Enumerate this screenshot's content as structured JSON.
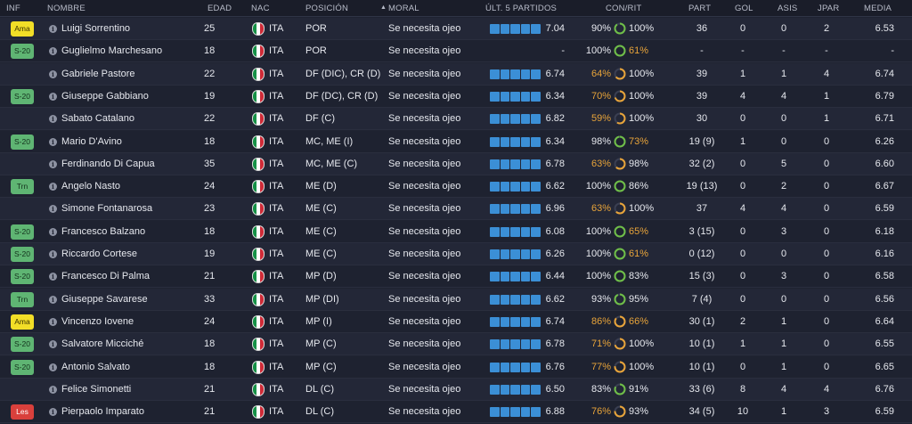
{
  "columns": {
    "inf": "INF",
    "nombre": "NOMBRE",
    "edad": "EDAD",
    "nac": "NAC",
    "posicion": "POSICIÓN",
    "moral": "MORAL",
    "ult5": "ÚLT. 5 PARTIDOS",
    "conrit": "CON/RIT",
    "part": "PART",
    "gol": "GOL",
    "asis": "ASIS",
    "jpar": "JPAR",
    "media": "MEDIA"
  },
  "sort": {
    "column": "moral",
    "direction": "ascending"
  },
  "colors": {
    "accent_blue": "#3b8fd6",
    "highlight_orange": "#e8a43a",
    "ring_green": "#6fbf48",
    "ring_orange": "#e8a43a",
    "badge_yellow": "#f2de27",
    "badge_green": "#5fb573",
    "badge_red": "#d9403c"
  },
  "players": [
    {
      "inf": "Ama",
      "inf_color": "yellow",
      "name": "Luigi Sorrentino",
      "age": "25",
      "nat": "ITA",
      "pos": "POR",
      "morale": "Se necesita ojeo",
      "last5": "7.04",
      "con": "90%",
      "con_low": false,
      "rit": "100%",
      "rit_low": false,
      "con_pct": 90,
      "rit_pct": 100,
      "part": "36",
      "gol": "0",
      "asis": "0",
      "jpar": "2",
      "media": "6.53"
    },
    {
      "inf": "S-20",
      "inf_color": "green",
      "name": "Guglielmo Marchesano",
      "age": "18",
      "nat": "ITA",
      "pos": "POR",
      "morale": "Se necesita ojeo",
      "last5": "-",
      "con": "100%",
      "con_low": false,
      "rit": "61%",
      "rit_low": true,
      "con_pct": 100,
      "rit_pct": 61,
      "part": "-",
      "gol": "-",
      "asis": "-",
      "jpar": "-",
      "media": "-"
    },
    {
      "inf": "",
      "inf_color": "",
      "name": "Gabriele Pastore",
      "age": "22",
      "nat": "ITA",
      "pos": "DF (DIC), CR (D)",
      "morale": "Se necesita ojeo",
      "last5": "6.74",
      "con": "64%",
      "con_low": true,
      "rit": "100%",
      "rit_low": false,
      "con_pct": 64,
      "rit_pct": 100,
      "part": "39",
      "gol": "1",
      "asis": "1",
      "jpar": "4",
      "media": "6.74"
    },
    {
      "inf": "S-20",
      "inf_color": "green",
      "name": "Giuseppe Gabbiano",
      "age": "19",
      "nat": "ITA",
      "pos": "DF (DC), CR (D)",
      "morale": "Se necesita ojeo",
      "last5": "6.34",
      "con": "70%",
      "con_low": true,
      "rit": "100%",
      "rit_low": false,
      "con_pct": 70,
      "rit_pct": 100,
      "part": "39",
      "gol": "4",
      "asis": "4",
      "jpar": "1",
      "media": "6.79"
    },
    {
      "inf": "",
      "inf_color": "",
      "name": "Sabato Catalano",
      "age": "22",
      "nat": "ITA",
      "pos": "DF (C)",
      "morale": "Se necesita ojeo",
      "last5": "6.82",
      "con": "59%",
      "con_low": true,
      "rit": "100%",
      "rit_low": false,
      "con_pct": 59,
      "rit_pct": 100,
      "part": "30",
      "gol": "0",
      "asis": "0",
      "jpar": "1",
      "media": "6.71"
    },
    {
      "inf": "S-20",
      "inf_color": "green",
      "name": "Mario D'Avino",
      "age": "18",
      "nat": "ITA",
      "pos": "MC, ME (I)",
      "morale": "Se necesita ojeo",
      "last5": "6.34",
      "con": "98%",
      "con_low": false,
      "rit": "73%",
      "rit_low": true,
      "con_pct": 98,
      "rit_pct": 73,
      "part": "19 (9)",
      "gol": "1",
      "asis": "0",
      "jpar": "0",
      "media": "6.26"
    },
    {
      "inf": "",
      "inf_color": "",
      "name": "Ferdinando Di Capua",
      "age": "35",
      "nat": "ITA",
      "pos": "MC, ME (C)",
      "morale": "Se necesita ojeo",
      "last5": "6.78",
      "con": "63%",
      "con_low": true,
      "rit": "98%",
      "rit_low": false,
      "con_pct": 63,
      "rit_pct": 98,
      "part": "32 (2)",
      "gol": "0",
      "asis": "5",
      "jpar": "0",
      "media": "6.60"
    },
    {
      "inf": "Trn",
      "inf_color": "green",
      "name": "Angelo Nasto",
      "age": "24",
      "nat": "ITA",
      "pos": "ME (D)",
      "morale": "Se necesita ojeo",
      "last5": "6.62",
      "con": "100%",
      "con_low": false,
      "rit": "86%",
      "rit_low": false,
      "con_pct": 100,
      "rit_pct": 86,
      "part": "19 (13)",
      "gol": "0",
      "asis": "2",
      "jpar": "0",
      "media": "6.67"
    },
    {
      "inf": "",
      "inf_color": "",
      "name": "Simone Fontanarosa",
      "age": "23",
      "nat": "ITA",
      "pos": "ME (C)",
      "morale": "Se necesita ojeo",
      "last5": "6.96",
      "con": "63%",
      "con_low": true,
      "rit": "100%",
      "rit_low": false,
      "con_pct": 63,
      "rit_pct": 100,
      "part": "37",
      "gol": "4",
      "asis": "4",
      "jpar": "0",
      "media": "6.59"
    },
    {
      "inf": "S-20",
      "inf_color": "green",
      "name": "Francesco Balzano",
      "age": "18",
      "nat": "ITA",
      "pos": "ME (C)",
      "morale": "Se necesita ojeo",
      "last5": "6.08",
      "con": "100%",
      "con_low": false,
      "rit": "65%",
      "rit_low": true,
      "con_pct": 100,
      "rit_pct": 65,
      "part": "3 (15)",
      "gol": "0",
      "asis": "3",
      "jpar": "0",
      "media": "6.18"
    },
    {
      "inf": "S-20",
      "inf_color": "green",
      "name": "Riccardo Cortese",
      "age": "19",
      "nat": "ITA",
      "pos": "ME (C)",
      "morale": "Se necesita ojeo",
      "last5": "6.26",
      "con": "100%",
      "con_low": false,
      "rit": "61%",
      "rit_low": true,
      "con_pct": 100,
      "rit_pct": 61,
      "part": "0 (12)",
      "gol": "0",
      "asis": "0",
      "jpar": "0",
      "media": "6.16"
    },
    {
      "inf": "S-20",
      "inf_color": "green",
      "name": "Francesco Di Palma",
      "age": "21",
      "nat": "ITA",
      "pos": "MP (D)",
      "morale": "Se necesita ojeo",
      "last5": "6.44",
      "con": "100%",
      "con_low": false,
      "rit": "83%",
      "rit_low": false,
      "con_pct": 100,
      "rit_pct": 83,
      "part": "15 (3)",
      "gol": "0",
      "asis": "3",
      "jpar": "0",
      "media": "6.58"
    },
    {
      "inf": "Trn",
      "inf_color": "green",
      "name": "Giuseppe Savarese",
      "age": "33",
      "nat": "ITA",
      "pos": "MP (DI)",
      "morale": "Se necesita ojeo",
      "last5": "6.62",
      "con": "93%",
      "con_low": false,
      "rit": "95%",
      "rit_low": false,
      "con_pct": 93,
      "rit_pct": 95,
      "part": "7 (4)",
      "gol": "0",
      "asis": "0",
      "jpar": "0",
      "media": "6.56"
    },
    {
      "inf": "Ama",
      "inf_color": "yellow",
      "name": "Vincenzo Iovene",
      "age": "24",
      "nat": "ITA",
      "pos": "MP (I)",
      "morale": "Se necesita ojeo",
      "last5": "6.74",
      "con": "86%",
      "con_low": true,
      "rit": "66%",
      "rit_low": true,
      "con_pct": 86,
      "rit_pct": 66,
      "part": "30 (1)",
      "gol": "2",
      "asis": "1",
      "jpar": "0",
      "media": "6.64"
    },
    {
      "inf": "S-20",
      "inf_color": "green",
      "name": "Salvatore Micciché",
      "age": "18",
      "nat": "ITA",
      "pos": "MP (C)",
      "morale": "Se necesita ojeo",
      "last5": "6.78",
      "con": "71%",
      "con_low": true,
      "rit": "100%",
      "rit_low": false,
      "con_pct": 71,
      "rit_pct": 100,
      "part": "10 (1)",
      "gol": "1",
      "asis": "1",
      "jpar": "0",
      "media": "6.55"
    },
    {
      "inf": "S-20",
      "inf_color": "green",
      "name": "Antonio Salvato",
      "age": "18",
      "nat": "ITA",
      "pos": "MP (C)",
      "morale": "Se necesita ojeo",
      "last5": "6.76",
      "con": "77%",
      "con_low": true,
      "rit": "100%",
      "rit_low": false,
      "con_pct": 77,
      "rit_pct": 100,
      "part": "10 (1)",
      "gol": "0",
      "asis": "1",
      "jpar": "0",
      "media": "6.65"
    },
    {
      "inf": "",
      "inf_color": "",
      "name": "Felice Simonetti",
      "age": "21",
      "nat": "ITA",
      "pos": "DL (C)",
      "morale": "Se necesita ojeo",
      "last5": "6.50",
      "con": "83%",
      "con_low": false,
      "rit": "91%",
      "rit_low": false,
      "con_pct": 83,
      "rit_pct": 91,
      "part": "33 (6)",
      "gol": "8",
      "asis": "4",
      "jpar": "4",
      "media": "6.76"
    },
    {
      "inf": "Les",
      "inf_color": "red",
      "name": "Pierpaolo Imparato",
      "age": "21",
      "nat": "ITA",
      "pos": "DL (C)",
      "morale": "Se necesita ojeo",
      "last5": "6.88",
      "con": "76%",
      "con_low": true,
      "rit": "93%",
      "rit_low": false,
      "con_pct": 76,
      "rit_pct": 93,
      "part": "34 (5)",
      "gol": "10",
      "asis": "1",
      "jpar": "3",
      "media": "6.59"
    }
  ]
}
